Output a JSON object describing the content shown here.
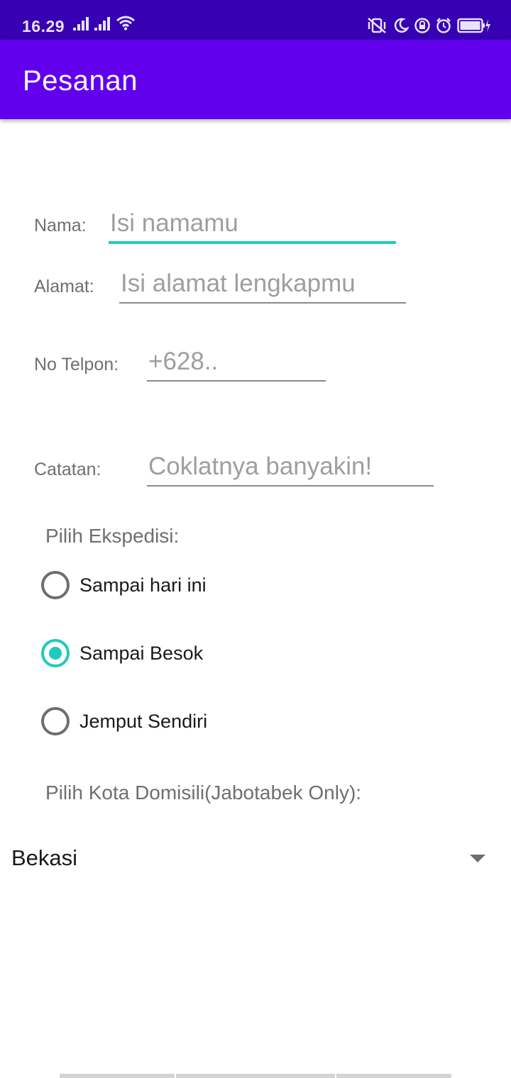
{
  "status_bar": {
    "time": "16.29",
    "icons_left": [
      "signal-icon",
      "signal-icon",
      "wifi-icon"
    ],
    "icons_right": [
      "vibrate-icon",
      "do-not-disturb-moon-icon",
      "rotation-lock-icon",
      "alarm-icon",
      "battery-charging-icon"
    ]
  },
  "app_bar": {
    "title": "Pesanan"
  },
  "form": {
    "nama": {
      "label": "Nama:",
      "placeholder": "Isi namamu",
      "value": ""
    },
    "alamat": {
      "label": "Alamat:",
      "placeholder": "Isi alamat lengkapmu",
      "value": ""
    },
    "telpon": {
      "label": "No Telpon:",
      "placeholder": "+628..",
      "value": ""
    },
    "catatan": {
      "label": "Catatan:",
      "placeholder": "Coklatnya banyakin!",
      "value": ""
    }
  },
  "ekspedisi": {
    "label": "Pilih Ekspedisi:",
    "options": [
      {
        "label": "Sampai hari ini",
        "checked": false
      },
      {
        "label": "Sampai Besok",
        "checked": true
      },
      {
        "label": "Jemput Sendiri",
        "checked": false
      }
    ]
  },
  "kota": {
    "label": "Pilih Kota Domisili(Jabotabek Only):",
    "selected": "Bekasi"
  },
  "colors": {
    "status_bar": "#3700b3",
    "app_bar": "#6200ee",
    "accent": "#1ecbbf"
  }
}
